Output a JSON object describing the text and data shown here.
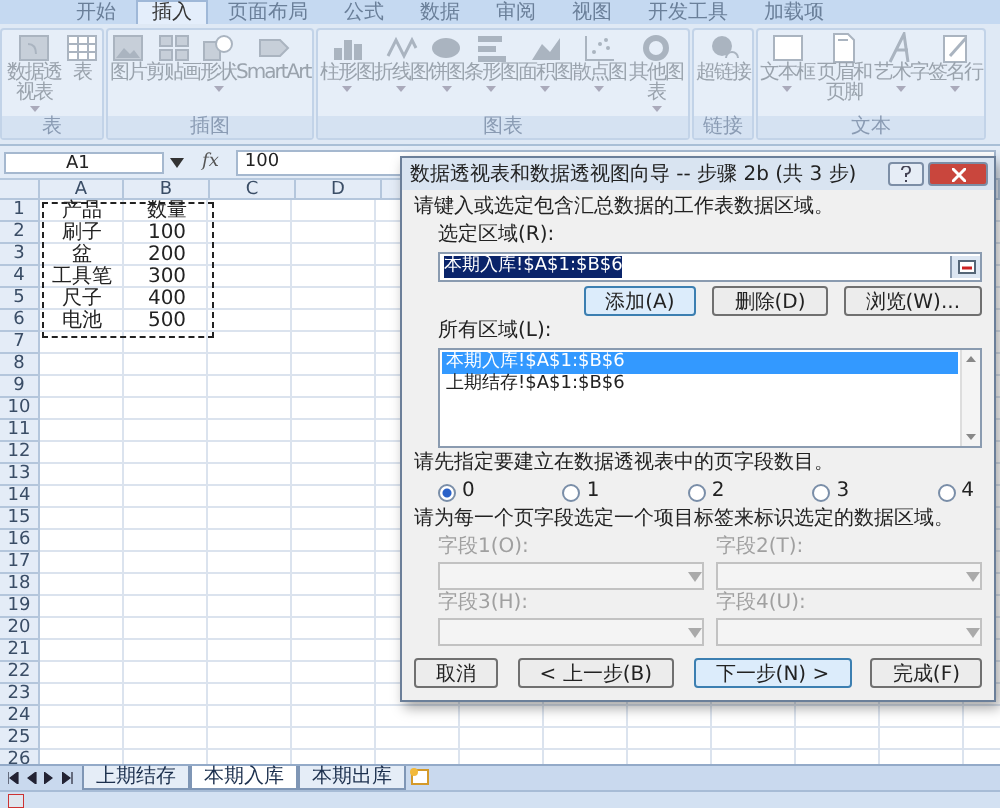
{
  "ribbon": {
    "tabs": [
      {
        "label": "开始",
        "selected": false
      },
      {
        "label": "插入",
        "selected": true
      },
      {
        "label": "页面布局",
        "selected": false
      },
      {
        "label": "公式",
        "selected": false
      },
      {
        "label": "数据",
        "selected": false
      },
      {
        "label": "审阅",
        "selected": false
      },
      {
        "label": "视图",
        "selected": false
      },
      {
        "label": "开发工具",
        "selected": false
      },
      {
        "label": "加载项",
        "selected": false
      }
    ],
    "groups": [
      {
        "label": "表",
        "buttons": [
          {
            "label": "数据透视表",
            "kind": "pivot",
            "dropdown": true
          },
          {
            "label": "表",
            "kind": "table",
            "dropdown": false
          }
        ]
      },
      {
        "label": "插图",
        "buttons": [
          {
            "label": "图片",
            "kind": "picture",
            "dropdown": false
          },
          {
            "label": "剪贴画",
            "kind": "clipart",
            "dropdown": false
          },
          {
            "label": "形状",
            "kind": "shapes",
            "dropdown": true
          },
          {
            "label": "SmartArt",
            "kind": "smartart",
            "dropdown": false
          }
        ]
      },
      {
        "label": "图表",
        "buttons": [
          {
            "label": "柱形图",
            "kind": "column",
            "dropdown": true
          },
          {
            "label": "折线图",
            "kind": "line",
            "dropdown": true
          },
          {
            "label": "饼图",
            "kind": "pie",
            "dropdown": true
          },
          {
            "label": "条形图",
            "kind": "bar",
            "dropdown": true
          },
          {
            "label": "面积图",
            "kind": "area",
            "dropdown": true
          },
          {
            "label": "散点图",
            "kind": "scatter",
            "dropdown": true
          },
          {
            "label": "其他图表",
            "kind": "other",
            "dropdown": true
          }
        ]
      },
      {
        "label": "链接",
        "buttons": [
          {
            "label": "超链接",
            "kind": "link",
            "dropdown": false
          }
        ]
      },
      {
        "label": "文本",
        "buttons": [
          {
            "label": "文本框",
            "kind": "textbox",
            "dropdown": true
          },
          {
            "label": "页眉和页脚",
            "kind": "header",
            "dropdown": false
          },
          {
            "label": "艺术字",
            "kind": "wordart",
            "dropdown": true
          },
          {
            "label": "签名行",
            "kind": "signature",
            "dropdown": true
          }
        ]
      }
    ]
  },
  "formula_bar": {
    "name_box": "A1",
    "function_label": "fx",
    "value": "100"
  },
  "sheet": {
    "columns": [
      "A",
      "B",
      "C",
      "D"
    ],
    "rows": [
      {
        "number": "1",
        "cells": [
          "产品",
          "数量"
        ]
      },
      {
        "number": "2",
        "cells": [
          "刷子",
          "100"
        ]
      },
      {
        "number": "3",
        "cells": [
          "盆",
          "200"
        ]
      },
      {
        "number": "4",
        "cells": [
          "工具笔",
          "300"
        ]
      },
      {
        "number": "5",
        "cells": [
          "尺子",
          "400"
        ]
      },
      {
        "number": "6",
        "cells": [
          "电池",
          "500"
        ]
      },
      {
        "number": "7",
        "cells": []
      },
      {
        "number": "8",
        "cells": []
      },
      {
        "number": "9",
        "cells": []
      },
      {
        "number": "10",
        "cells": []
      },
      {
        "number": "11",
        "cells": []
      },
      {
        "number": "12",
        "cells": []
      },
      {
        "number": "13",
        "cells": []
      },
      {
        "number": "14",
        "cells": []
      },
      {
        "number": "15",
        "cells": []
      },
      {
        "number": "16",
        "cells": []
      },
      {
        "number": "17",
        "cells": []
      },
      {
        "number": "18",
        "cells": []
      },
      {
        "number": "19",
        "cells": []
      },
      {
        "number": "20",
        "cells": []
      },
      {
        "number": "21",
        "cells": []
      },
      {
        "number": "22",
        "cells": []
      },
      {
        "number": "23",
        "cells": []
      },
      {
        "number": "24",
        "cells": []
      },
      {
        "number": "25",
        "cells": []
      },
      {
        "number": "26",
        "cells": []
      }
    ]
  },
  "dialog": {
    "title": "数据透视表和数据透视图向导 -- 步骤 2b (共 3 步)",
    "prompt": "请键入或选定包含汇总数据的工作表数据区域。",
    "range_label": "选定区域(R):",
    "range_value": "本期入库!$A$1:$B$6",
    "range_buttons": [
      {
        "label": "添加(A)",
        "default": true
      },
      {
        "label": "删除(D)",
        "default": false
      },
      {
        "label": "浏览(W)...",
        "default": false
      }
    ],
    "all_ranges_label": "所有区域(L):",
    "all_ranges": [
      {
        "label": "本期入库!$A$1:$B$6",
        "selected": true
      },
      {
        "label": "上期结存!$A$1:$B$6",
        "selected": false
      }
    ],
    "page_fields_prompt": "请先指定要建立在数据透视表中的页字段数目。",
    "page_field_counts": [
      {
        "label": "0",
        "selected": true
      },
      {
        "label": "1",
        "selected": false
      },
      {
        "label": "2",
        "selected": false
      },
      {
        "label": "3",
        "selected": false
      },
      {
        "label": "4",
        "selected": false
      }
    ],
    "labels_prompt": "请为每一个页字段选定一个项目标签来标识选定的数据区域。",
    "fields": [
      {
        "label": "字段1(O):",
        "disabled": true
      },
      {
        "label": "字段2(T):",
        "disabled": true
      },
      {
        "label": "字段3(H):",
        "disabled": true
      },
      {
        "label": "字段4(U):",
        "disabled": true
      }
    ],
    "buttons": [
      {
        "label": "取消",
        "default": false
      },
      {
        "label": "< 上一步(B)",
        "default": false
      },
      {
        "label": "下一步(N) >",
        "default": true
      },
      {
        "label": "完成(F)",
        "default": false
      }
    ]
  },
  "sheet_tabs": [
    {
      "label": "上期结存",
      "selected": false
    },
    {
      "label": "本期入库",
      "selected": true
    },
    {
      "label": "本期出库",
      "selected": false
    }
  ]
}
